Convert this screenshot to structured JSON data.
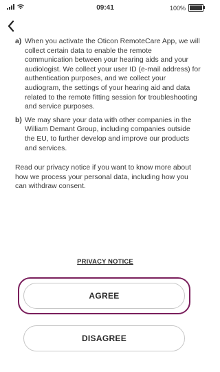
{
  "status_bar": {
    "time": "09:41",
    "battery_text": "100%"
  },
  "consent": {
    "clauses": [
      {
        "letter": "a)",
        "text": "When you activate the Oticon RemoteCare App, we will collect certain data to enable the remote communication between your hearing aids and your audiologist. We collect your user ID (e-mail address) for authentication purposes, and we collect your audiogram, the settings of your hearing aid and data related to the remote fitting session for troubleshooting and service purposes."
      },
      {
        "letter": "b)",
        "text": "We may share your data with other companies in the William Demant Group, including companies outside the EU, to further develop and improve our products and services."
      }
    ],
    "notice": "Read our privacy notice if you want to know more about how we process your personal data, including how you can withdraw consent."
  },
  "privacy_link": "PRIVACY NOTICE",
  "buttons": {
    "agree": "AGREE",
    "disagree": "DISAGREE"
  },
  "colors": {
    "highlight": "#7a1f5c",
    "button_border": "#c7c7c7"
  },
  "icons": {
    "back": "chevron-left-icon",
    "signal": "cellular-signal-icon",
    "wifi": "wifi-icon",
    "battery": "battery-icon"
  }
}
